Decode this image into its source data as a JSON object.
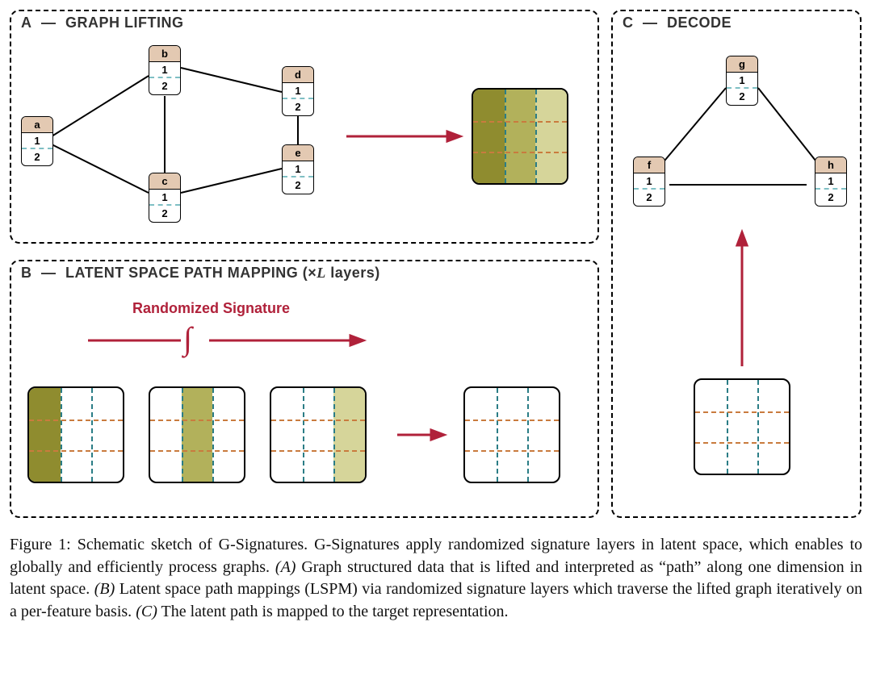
{
  "panels": {
    "A": {
      "prefix": "A",
      "dash": "—",
      "title": "GRAPH LIFTING"
    },
    "B": {
      "prefix": "B",
      "dash": "—",
      "title": "LATENT SPACE PATH MAPPING (×L layers)"
    },
    "C": {
      "prefix": "C",
      "dash": "—",
      "title": "DECODE"
    }
  },
  "nodes": {
    "a": {
      "head": "a",
      "r1": "1",
      "r2": "2"
    },
    "b": {
      "head": "b",
      "r1": "1",
      "r2": "2"
    },
    "c": {
      "head": "c",
      "r1": "1",
      "r2": "2"
    },
    "d": {
      "head": "d",
      "r1": "1",
      "r2": "2"
    },
    "e": {
      "head": "e",
      "r1": "1",
      "r2": "2"
    },
    "f": {
      "head": "f",
      "r1": "1",
      "r2": "2"
    },
    "g": {
      "head": "g",
      "r1": "1",
      "r2": "2"
    },
    "h": {
      "head": "h",
      "r1": "1",
      "r2": "2"
    }
  },
  "rsig": {
    "label": "Randomized Signature",
    "integral": "∫"
  },
  "colors": {
    "accent": "#b0213a",
    "band1": "#8f8c2f",
    "band2": "#b2b15b",
    "band3": "#d6d59a",
    "vdash": "#2b7d86",
    "hdash": "#c97b3e"
  },
  "caption": {
    "lead": "Figure 1:  Schematic sketch of G-Signatures. G-Signatures apply randomized signature layers in latent space, which enables to globally and efficiently process graphs. ",
    "A_tag": "(A)",
    "A_text": " Graph structured data that is lifted and interpreted as “path” along one dimension in latent space. ",
    "B_tag": "(B)",
    "B_text": " Latent space path mappings (LSPM) via randomized signature layers which traverse the lifted graph iteratively on a per-feature basis. ",
    "C_tag": "(C)",
    "C_text": " The latent path is mapped to the target representation."
  }
}
